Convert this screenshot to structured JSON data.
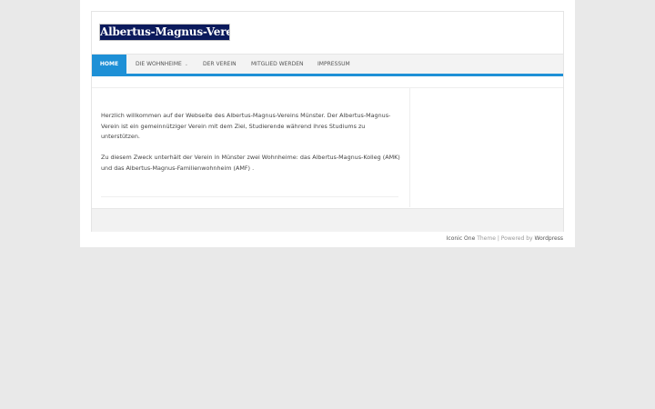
{
  "header": {
    "logo_text": "Albertus-Magnus-Verein"
  },
  "nav": {
    "items": [
      {
        "label": "HOME",
        "active": true
      },
      {
        "label": "DIE WOHNHEIME",
        "has_submenu": true
      },
      {
        "label": "DER VEREIN"
      },
      {
        "label": "MITGLIED WERDEN"
      },
      {
        "label": "IMPRESSUM"
      }
    ],
    "submenu_caret": "⌄"
  },
  "content": {
    "paragraphs": [
      "Herzlich willkommen auf der Webseite des Albertus-Magnus-Vereins Münster.  Der Albertus-Magnus-Verein ist ein gemeinnütziger Verein mit dem Ziel, Studierende während ihres Studiums zu unterstützen.",
      "Zu diesem Zweck unterhält der Verein in Münster zwei Wohnheime: das Albertus-Magnus-Kolleg (AMK) und das Albertus-Magnus-Familienwohnheim (AMF) ."
    ]
  },
  "footer": {
    "theme_link": "Iconic One",
    "theme_word": "Theme",
    "separator": "|",
    "powered_by": "Powered by",
    "wordpress_link": "Wordpress"
  },
  "colors": {
    "accent": "#1e90d6",
    "logo_bg": "#0b1a5c",
    "page_bg": "#e9e9e9"
  }
}
